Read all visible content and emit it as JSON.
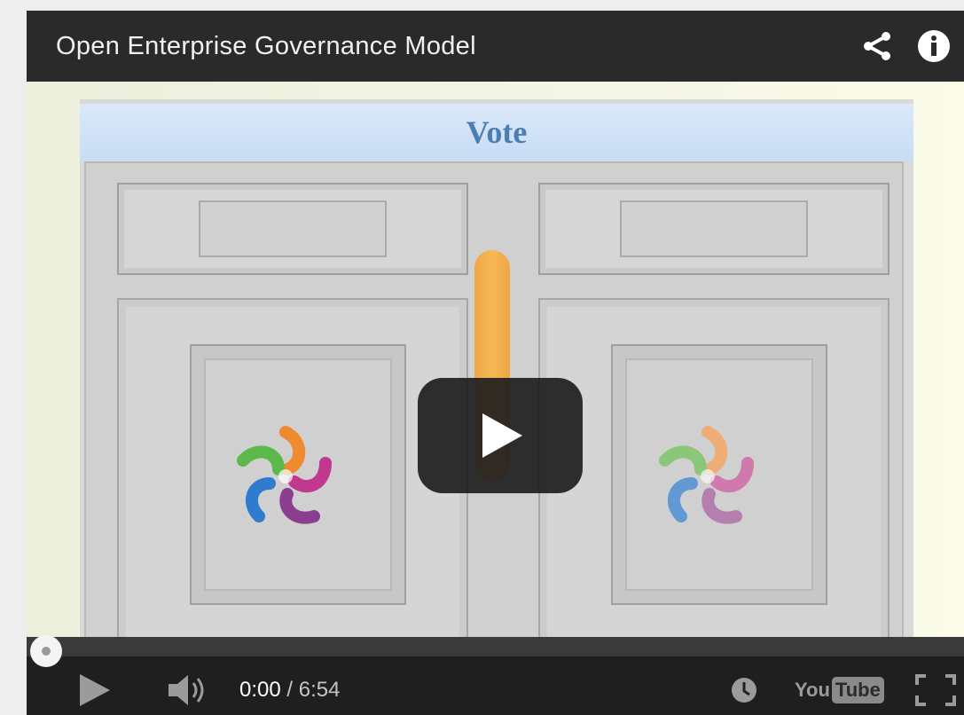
{
  "player": {
    "title": "Open Enterprise Governance Model",
    "share_icon": "share-icon",
    "info_icon": "info-icon"
  },
  "video": {
    "banner_text": "Vote",
    "logo_icon": "open-enterprise-logo-icon",
    "play_icon": "play-icon"
  },
  "controls": {
    "current_time": "0:00",
    "separator": " / ",
    "total_time": "6:54",
    "progress": 0,
    "brand_you": "You",
    "brand_tube": "Tube",
    "icons": [
      "play-icon",
      "volume-icon",
      "watch-later-icon",
      "youtube-logo",
      "fullscreen-icon"
    ]
  },
  "colors": {
    "title_bar": "#2a2a2a",
    "control_bar": "#1f1f1f",
    "vote_text": "#4b7fb3",
    "handle": "#f5a843"
  }
}
